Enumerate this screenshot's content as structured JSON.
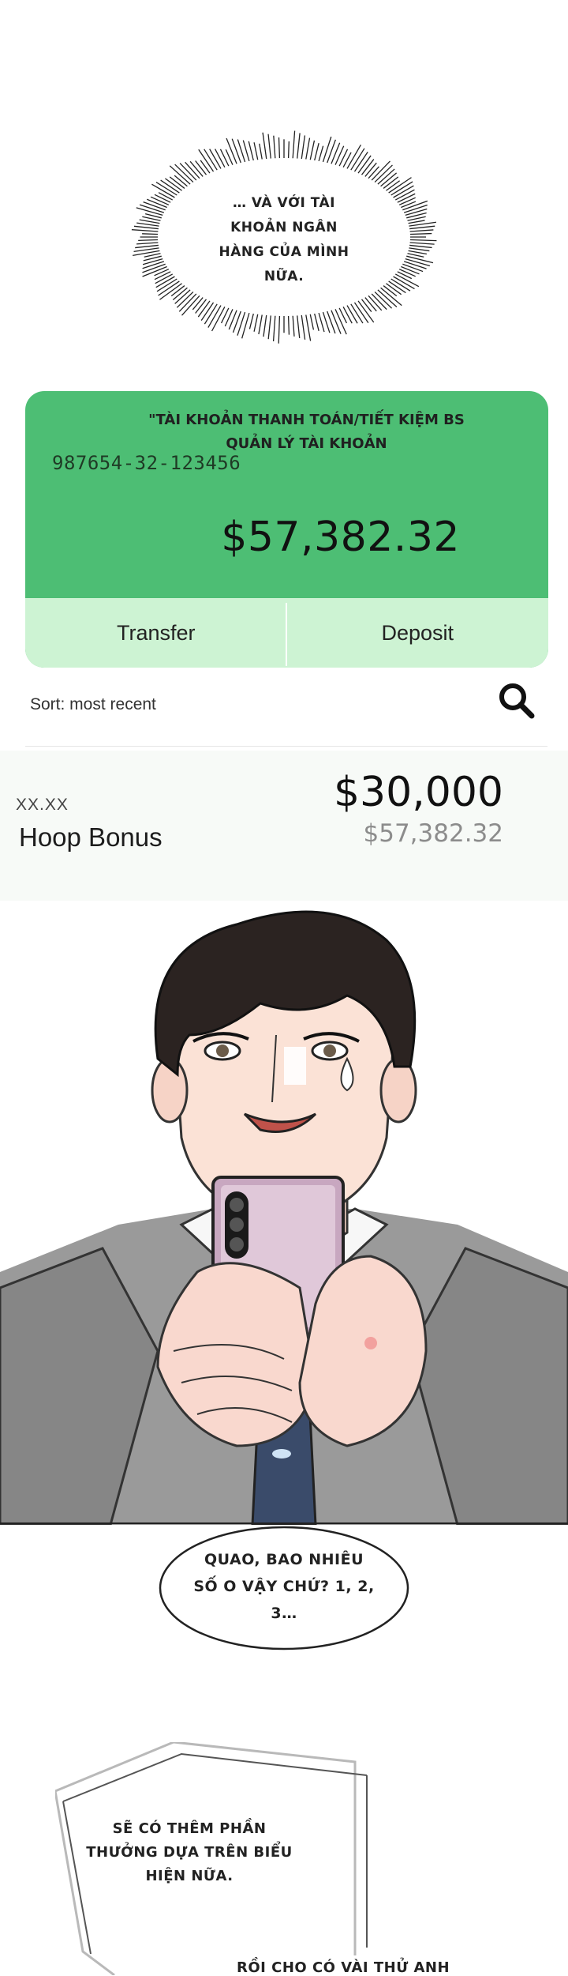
{
  "thought": {
    "lines": [
      "… VÀ VỚI TÀI",
      "KHOẢN NGÂN",
      "HÀNG CỦA MÌNH",
      "NỮA."
    ]
  },
  "card": {
    "title_line1": "\"TÀI KHOẢN THANH TOÁN/TIẾT KIỆM BS",
    "title_line2": "QUẢN LÝ TÀI KHOẢN",
    "account_number": "987654-32-123456",
    "balance": "$57,382.32",
    "transfer_label": "Transfer",
    "deposit_label": "Deposit",
    "color": "#4dbe74",
    "action_bg": "#cdf3d3"
  },
  "sort": {
    "label": "Sort: most recent",
    "search_icon": "search-icon"
  },
  "transaction": {
    "date": "XX.XX",
    "title": "Hoop Bonus",
    "amount": "$30,000",
    "running_balance": "$57,382.32"
  },
  "speech": {
    "lines": [
      "QUAO, BAO NHIÊU",
      "SỐ O VẬY CHỨ? 1, 2,",
      "3…"
    ]
  },
  "narration": {
    "lines": [
      "SẼ CÓ THÊM PHẦN",
      "THƯỞNG DỰA TRÊN BIỂU",
      "HIỆN NỮA."
    ],
    "cut_text": "RỒI CHO CÓ VÀI THỬ ANH"
  }
}
